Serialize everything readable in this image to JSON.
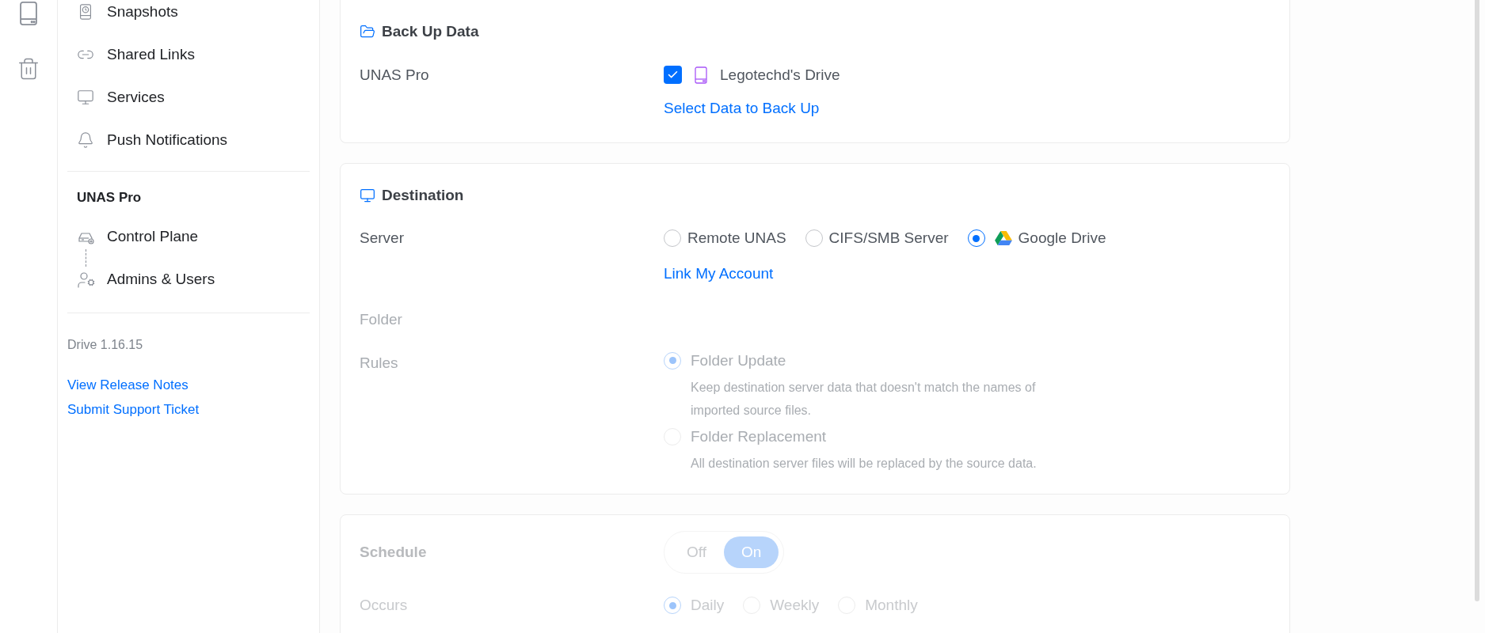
{
  "sidebar": {
    "items": [
      {
        "label": "Snapshots"
      },
      {
        "label": "Shared Links"
      },
      {
        "label": "Services"
      },
      {
        "label": "Push Notifications"
      }
    ],
    "section": {
      "title": "UNAS Pro",
      "items": [
        {
          "label": "Control Plane"
        },
        {
          "label": "Admins & Users"
        }
      ]
    },
    "version": "Drive 1.16.15",
    "links": [
      "View Release Notes",
      "Submit Support Ticket"
    ]
  },
  "backup": {
    "title": "Back Up Data",
    "source_label": "UNAS Pro",
    "source": {
      "label": "Legotechd's Drive",
      "checked": true
    },
    "link": "Select Data to Back Up"
  },
  "destination": {
    "title": "Destination",
    "server_label": "Server",
    "servers": [
      {
        "label": "Remote UNAS",
        "selected": false
      },
      {
        "label": "CIFS/SMB Server",
        "selected": false
      },
      {
        "label": "Google Drive",
        "selected": true
      }
    ],
    "link": "Link My Account",
    "folder_label": "Folder",
    "rules_label": "Rules",
    "disabled": true,
    "rules": [
      {
        "label": "Folder Update",
        "description": "Keep destination server data that doesn't match the names of imported source files.",
        "selected": true
      },
      {
        "label": "Folder Replacement",
        "description": "All destination server files will be replaced by the source data.",
        "selected": false
      }
    ]
  },
  "schedule": {
    "title": "Schedule",
    "disabled": true,
    "toggle": [
      {
        "label": "Off",
        "selected": false
      },
      {
        "label": "On",
        "selected": true
      }
    ],
    "occurs_label": "Occurs",
    "occurs": [
      {
        "label": "Daily",
        "selected": true
      },
      {
        "label": "Weekly",
        "selected": false
      },
      {
        "label": "Monthly",
        "selected": false
      }
    ]
  }
}
